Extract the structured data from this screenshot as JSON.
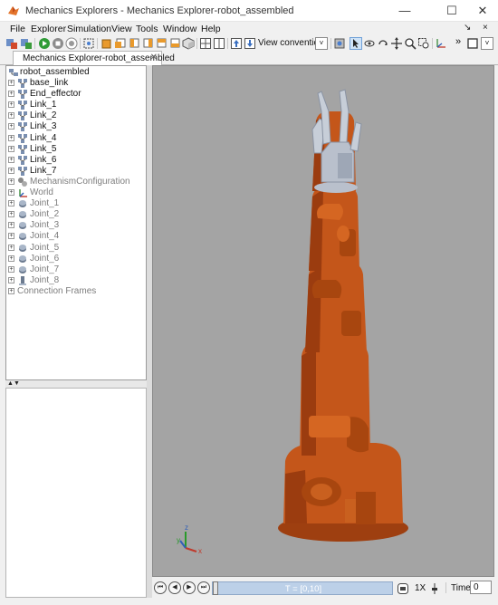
{
  "window": {
    "title": "Mechanics Explorers - Mechanics Explorer-robot_assembled",
    "minimize_glyph": "—",
    "maximize_glyph": "☐",
    "close_glyph": "✕"
  },
  "menu": {
    "items": [
      "File",
      "Explorer",
      "Simulation",
      "View",
      "Tools",
      "Window",
      "Help"
    ],
    "right_glyphs": [
      "↘",
      "×"
    ]
  },
  "toolbar": {
    "view_convention_label": "View convention:",
    "view_convention_arrow": "˅",
    "more_glyph": "»",
    "dropdown_arrow": "˅"
  },
  "tab": {
    "label": "Mechanics Explorer-robot_assembled",
    "close_glyph": "✕"
  },
  "tree": {
    "root": "robot_assembled",
    "expander_glyph": "+",
    "items": [
      {
        "label": "base_link",
        "icon": "frame-icon",
        "style": "dark"
      },
      {
        "label": "End_effector",
        "icon": "frame-icon",
        "style": "dark"
      },
      {
        "label": "Link_1",
        "icon": "frame-icon",
        "style": "dark"
      },
      {
        "label": "Link_2",
        "icon": "frame-icon",
        "style": "dark"
      },
      {
        "label": "Link_3",
        "icon": "frame-icon",
        "style": "dark"
      },
      {
        "label": "Link_4",
        "icon": "frame-icon",
        "style": "dark"
      },
      {
        "label": "Link_5",
        "icon": "frame-icon",
        "style": "dark"
      },
      {
        "label": "Link_6",
        "icon": "frame-icon",
        "style": "dark"
      },
      {
        "label": "Link_7",
        "icon": "frame-icon",
        "style": "dark"
      },
      {
        "label": "MechanismConfiguration",
        "icon": "mechanism-icon",
        "style": "gray"
      },
      {
        "label": "World",
        "icon": "world-icon",
        "style": "gray"
      },
      {
        "label": "Joint_1",
        "icon": "revolute-joint-icon",
        "style": "gray"
      },
      {
        "label": "Joint_2",
        "icon": "revolute-joint-icon",
        "style": "gray"
      },
      {
        "label": "Joint_3",
        "icon": "revolute-joint-icon",
        "style": "gray"
      },
      {
        "label": "Joint_4",
        "icon": "revolute-joint-icon",
        "style": "gray"
      },
      {
        "label": "Joint_5",
        "icon": "revolute-joint-icon",
        "style": "gray"
      },
      {
        "label": "Joint_6",
        "icon": "revolute-joint-icon",
        "style": "gray"
      },
      {
        "label": "Joint_7",
        "icon": "revolute-joint-icon",
        "style": "gray"
      },
      {
        "label": "Joint_8",
        "icon": "prismatic-joint-icon",
        "style": "gray"
      },
      {
        "label": "Connection Frames",
        "icon": "none",
        "style": "gray"
      }
    ]
  },
  "splitter": {
    "arrows": [
      "▲",
      "▼"
    ]
  },
  "viewport": {
    "axis_labels": {
      "x": "x",
      "y": "y",
      "z": "z"
    },
    "colors": {
      "background": "#a4a4a4",
      "robot_body": "#c4561a",
      "gripper": "#b9c0cc"
    }
  },
  "playback": {
    "buttons": [
      "⏮",
      "◀",
      "▶",
      "⏭"
    ],
    "time_range_label": "T = [0,10]",
    "speed_label": "1X",
    "time_label": "Time",
    "time_value": "0"
  }
}
